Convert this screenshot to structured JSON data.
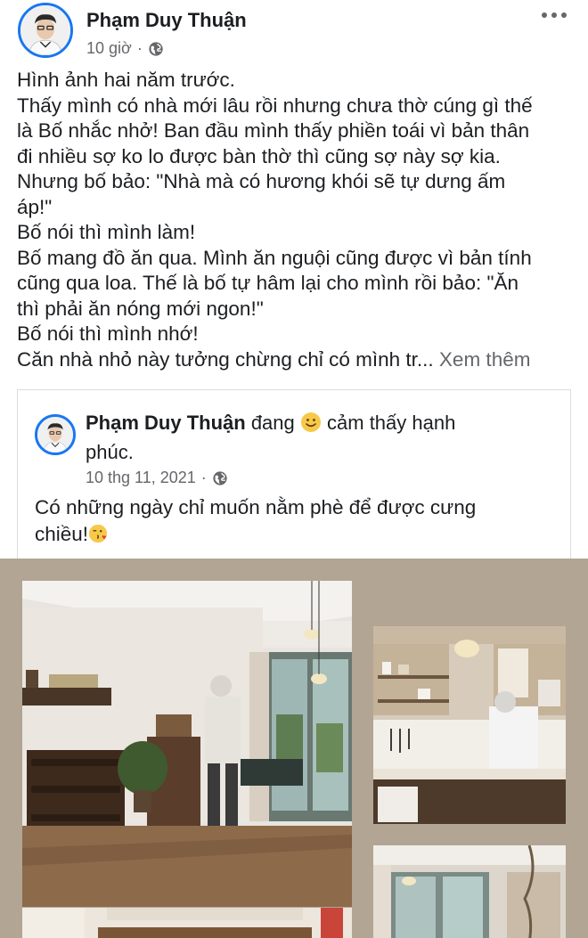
{
  "post": {
    "author": "Phạm Duy Thuận",
    "time": "10 giờ",
    "separator": "·",
    "lines": [
      "Hình ảnh hai năm trước.",
      "Thấy mình có nhà mới lâu rồi nhưng chưa thờ cúng gì thế",
      "là Bố nhắc nhở! Ban đầu mình thấy phiền toái vì bản thân",
      "đi nhiều sợ ko lo được bàn thờ thì cũng sợ này sợ kia.",
      "Nhưng bố bảo: \"Nhà mà có hương khói sẽ tự dưng ấm",
      "áp!\"",
      "Bố nói thì mình làm!",
      "Bố mang đồ ăn qua. Mình ăn nguội cũng được vì bản tính",
      "cũng qua loa. Thế là bố tự hâm lại cho mình rồi bảo: \"Ăn",
      "thì phải ăn nóng mới ngon!\"",
      "Bố nói thì mình nhớ!"
    ],
    "last_line": "Căn nhà nhỏ này tưởng chừng chỉ có mình tr...",
    "see_more": "Xem thêm"
  },
  "shared": {
    "author": "Phạm Duy Thuận",
    "feeling_prefix": "đang",
    "feeling_text": "cảm thấy hạnh",
    "feeling_text_2": "phúc.",
    "date": "10 thg 11, 2021",
    "separator": "·",
    "text": "Có những ngày chỉ muốn nằm phè để được cưng",
    "text_2": "chiều!"
  },
  "icons": {
    "more": "more-horizontal-icon",
    "privacy": "globe-icon",
    "feeling": "smiling-face-emoji",
    "kiss": "face-blowing-kiss-emoji"
  },
  "colors": {
    "accent": "#1877f2",
    "secondary_text": "#65676b",
    "photo_background": "#b2a594"
  }
}
